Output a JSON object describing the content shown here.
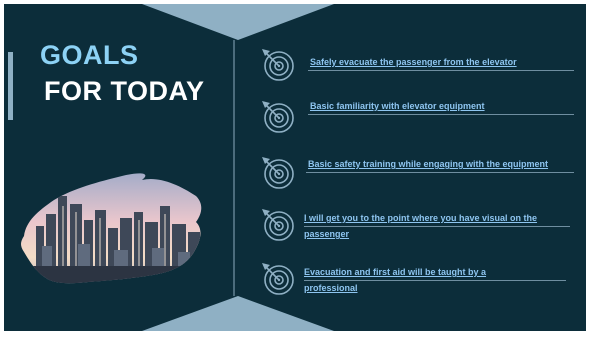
{
  "title": {
    "line1": "GOALS",
    "line2": "FOR TODAY"
  },
  "colors": {
    "background": "#0c2d3a",
    "title_accent": "#8dd2f5",
    "title_main": "#ffffff",
    "goal_text": "#8ec5f0",
    "decoration": "#8fb0c4"
  },
  "goals": [
    {
      "text": "Safely evacuate the passenger from the elevator",
      "icon": "target-arrow-icon"
    },
    {
      "text": "Basic familiarity with elevator equipment",
      "icon": "target-arrow-icon"
    },
    {
      "text": "Basic safety training while engaging with the equipment",
      "icon": "target-arrow-icon"
    },
    {
      "text": "I will get you to the point where you have visual on the passenger",
      "icon": "target-arrow-icon"
    },
    {
      "text": "Evacuation and first aid will be taught by a professional",
      "icon": "target-arrow-icon"
    }
  ]
}
